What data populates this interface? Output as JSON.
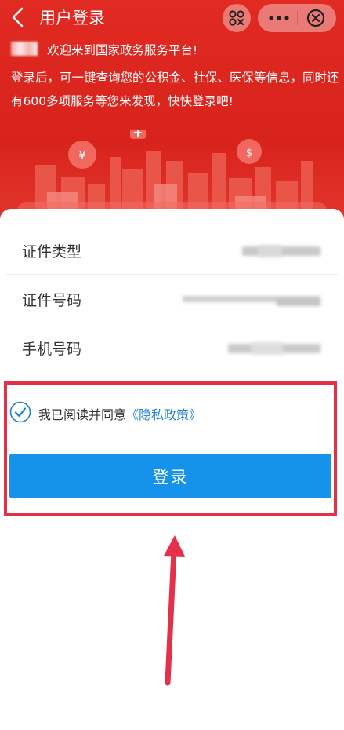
{
  "header": {
    "title": "用户登录"
  },
  "welcome": "欢迎来到国家政务服务平台!",
  "description": "登录后，可一键查询您的公积金、社保、医保等信息，同时还有600多项服务等您来发现，快快登录吧!",
  "form": {
    "rows": [
      {
        "label": "证件类型"
      },
      {
        "label": "证件号码"
      },
      {
        "label": "手机号码"
      }
    ]
  },
  "agreement": {
    "text": "我已阅读并同意",
    "link": "《隐私政策》",
    "checked": true
  },
  "login_button": "登录",
  "colors": {
    "header_red": "#d8231c",
    "button_blue": "#1592ea",
    "link_blue": "#1e7fd8",
    "highlight_red": "#e5304a"
  },
  "icons": [
    "back-icon",
    "scan-qr-icon",
    "more-icon",
    "close-icon",
    "check-icon",
    "house-yen-icon",
    "medical-cross-icon",
    "social-security-icon"
  ]
}
